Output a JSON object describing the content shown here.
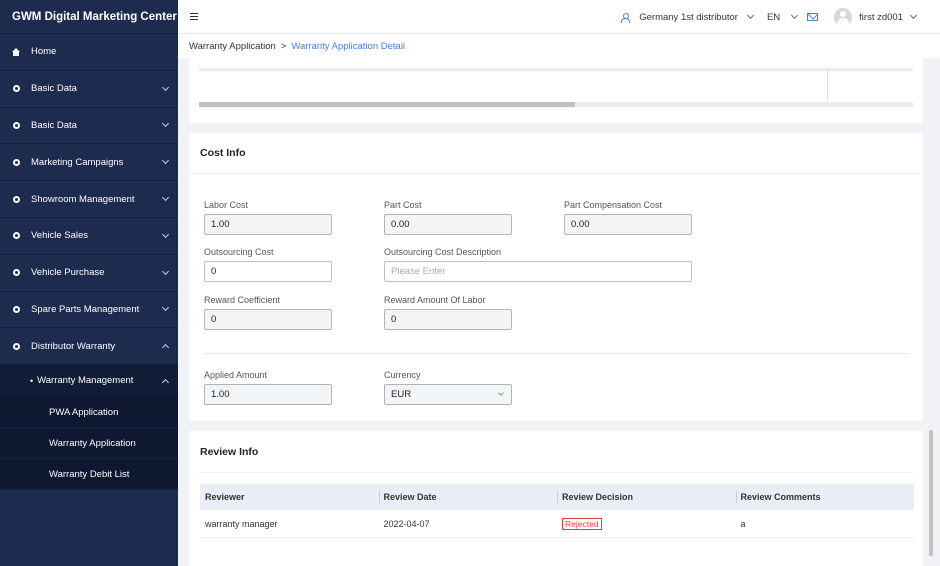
{
  "app": {
    "title": "GWM Digital Marketing Center"
  },
  "sidebar": {
    "items": [
      {
        "label": "Home",
        "icon": "home-icon"
      },
      {
        "label": "Basic Data",
        "icon": "dot-icon"
      },
      {
        "label": "Basic Data",
        "icon": "dot-icon"
      },
      {
        "label": "Marketing Campaigns",
        "icon": "dot-icon"
      },
      {
        "label": "Showroom Management",
        "icon": "dot-icon"
      },
      {
        "label": "Vehicle Sales",
        "icon": "dot-icon"
      },
      {
        "label": "Vehicle Purchase",
        "icon": "dot-icon"
      },
      {
        "label": "Spare Parts Management",
        "icon": "dot-icon"
      },
      {
        "label": "Distributor Warranty",
        "icon": "dot-icon"
      }
    ],
    "submenu": {
      "label": "Warranty Management",
      "bullet": "•"
    },
    "leaves": [
      "PWA Application",
      "Warranty Application",
      "Warranty Debit List"
    ]
  },
  "header": {
    "distributor": "Germany 1st distributor",
    "language": "EN",
    "user": "first zd001"
  },
  "breadcrumb": {
    "parent": "Warranty Application",
    "separator": ">",
    "current": "Warranty Application Detail"
  },
  "cost_info": {
    "title": "Cost Info",
    "labor_cost": {
      "label": "Labor Cost",
      "value": "1.00"
    },
    "part_cost": {
      "label": "Part Cost",
      "value": "0.00"
    },
    "part_compensation_cost": {
      "label": "Part Compensation Cost",
      "value": "0.00"
    },
    "outsourcing_cost": {
      "label": "Outsourcing Cost",
      "value": "0"
    },
    "outsourcing_cost_description": {
      "label": "Outsourcing Cost Description",
      "placeholder": "Please Enter"
    },
    "reward_coefficient": {
      "label": "Reward Coefficient",
      "value": "0"
    },
    "reward_amount_of_labor": {
      "label": "Reward Amount Of Labor",
      "value": "0"
    },
    "applied_amount": {
      "label": "Applied Amount",
      "value": "1.00"
    },
    "currency": {
      "label": "Currency",
      "value": "EUR"
    }
  },
  "review_info": {
    "title": "Review Info",
    "columns": [
      "Reviewer",
      "Review Date",
      "Review Decision",
      "Review Comments"
    ],
    "rows": [
      {
        "reviewer": "warranty manager",
        "date": "2022-04-07",
        "decision": "Rejected",
        "comments": "a"
      }
    ]
  },
  "colors": {
    "sidebar_bg": "#1d2b4f",
    "accent": "#4a7fd4",
    "rejected": "#e04040"
  }
}
